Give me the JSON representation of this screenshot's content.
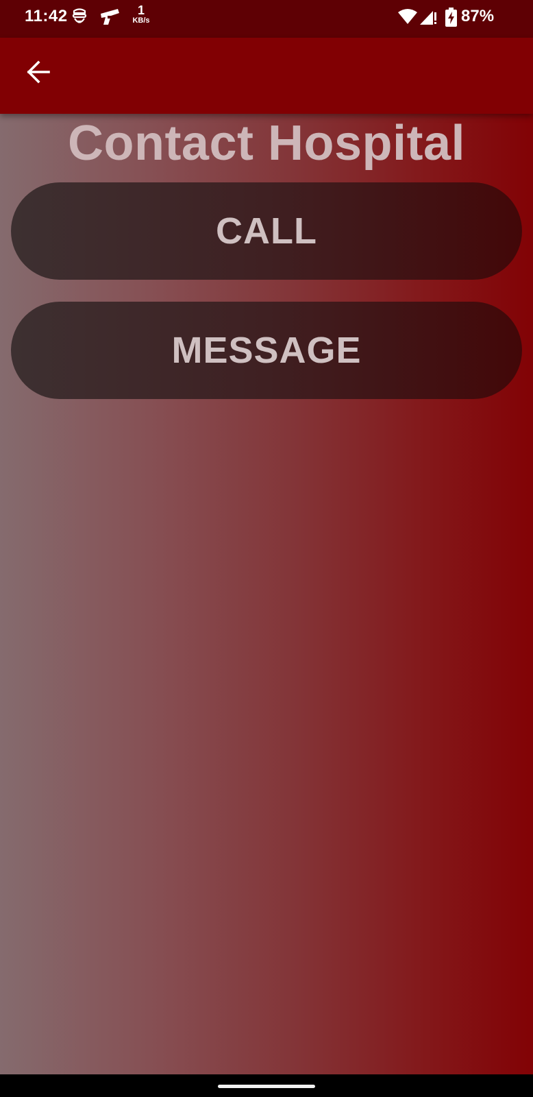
{
  "status_bar": {
    "time": "11:42",
    "speed_value": "1",
    "speed_unit": "KB/s",
    "battery_percent": "87%",
    "icons": [
      "vpn-robber-icon",
      "gun-icon",
      "wifi-icon",
      "cell-signal-icon",
      "battery-charging-icon"
    ]
  },
  "app_bar": {
    "back_icon": "arrow-back-icon"
  },
  "page": {
    "title": "Contact Hospital"
  },
  "actions": {
    "call_label": "CALL",
    "message_label": "MESSAGE"
  },
  "colors": {
    "status_bar": "#5e0004",
    "app_bar": "#810003",
    "title_text": "#cdb6b8",
    "button_text": "#cfc0c1",
    "gradient_left": "#856b6e",
    "gradient_right": "#820205"
  }
}
